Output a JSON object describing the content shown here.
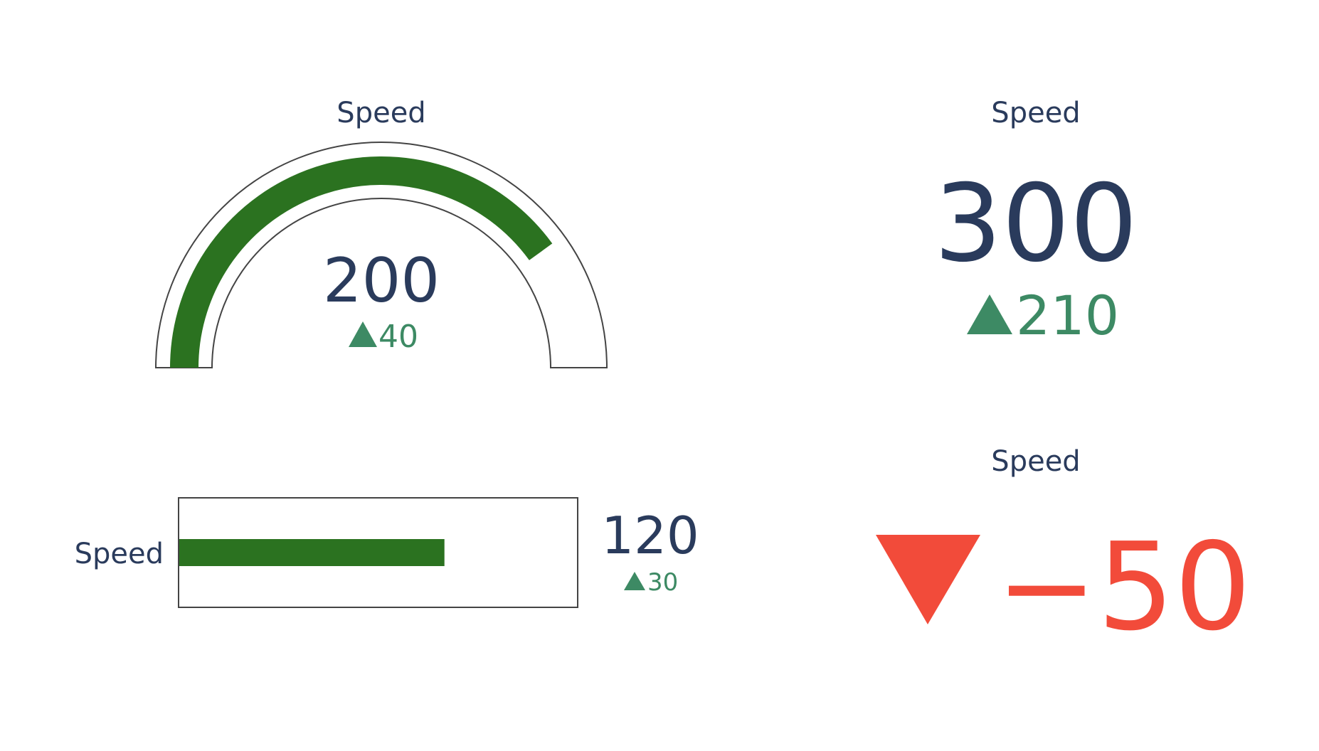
{
  "colors": {
    "number": "#2a3b5c",
    "gauge_bar": "#2b7220",
    "increase": "#3d8a64",
    "decrease": "#f24b3a",
    "outline": "#444444"
  },
  "chart_data": [
    {
      "type": "gauge",
      "title": "Speed",
      "value": 200,
      "delta": 40,
      "delta_direction": "increasing",
      "axis_range": [
        0,
        250
      ]
    },
    {
      "type": "number",
      "title": "Speed",
      "value": 300,
      "delta": 210,
      "delta_direction": "increasing"
    },
    {
      "type": "bullet",
      "title": "Speed",
      "value": 120,
      "delta": 30,
      "delta_direction": "increasing",
      "axis_range": [
        0,
        180
      ]
    },
    {
      "type": "delta",
      "title": "Speed",
      "delta": "−50",
      "delta_direction": "decreasing"
    }
  ]
}
